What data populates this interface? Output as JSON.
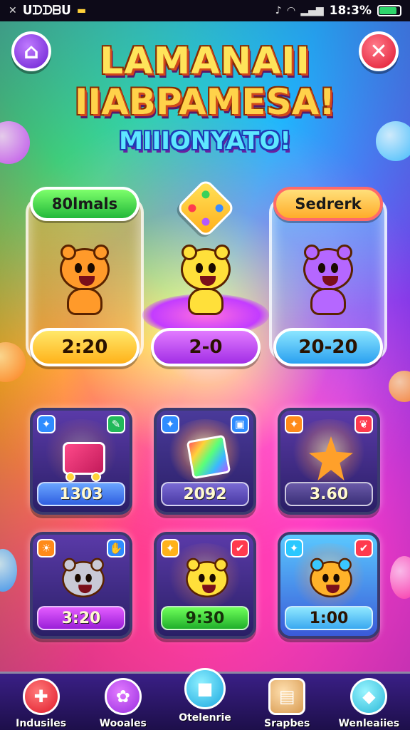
{
  "status_bar": {
    "carrier": "ᑌᗪᗪᗷᑌ",
    "time": "18:3%"
  },
  "title": {
    "line1": "LAMANAII",
    "line2": "IIABPAMESA!",
    "subtitle": "MIIIONYATO!"
  },
  "features": [
    {
      "tag": "80lmals",
      "price": "2:20",
      "color": "orange",
      "mascot_color": "orange"
    },
    {
      "tag": "",
      "price": "2-0",
      "color": "purple",
      "mascot_color": "yellow"
    },
    {
      "tag": "Sedrerk",
      "price": "20-20",
      "color": "blue",
      "mascot_color": "purple"
    }
  ],
  "items": [
    {
      "label": "1303",
      "badge_left_icon": "sparkle-icon",
      "badge_right_icon": "pencil-icon"
    },
    {
      "label": "2092",
      "badge_left_icon": "sparkle-icon",
      "badge_right_icon": "bag-icon"
    },
    {
      "label": "3.60",
      "badge_left_icon": "sparkle-icon",
      "badge_right_icon": "ribbon-icon"
    },
    {
      "label": "3:20",
      "badge_left_icon": "sun-icon",
      "badge_right_icon": "hand-icon"
    },
    {
      "label": "9:30",
      "badge_left_icon": "sparkle-icon",
      "badge_right_icon": "check-icon"
    },
    {
      "label": "1:00",
      "badge_left_icon": "sparkle-icon",
      "badge_right_icon": "check-icon"
    }
  ],
  "nav": [
    {
      "label": "Indusiles",
      "icon": "puzzle-icon"
    },
    {
      "label": "Wooales",
      "icon": "flower-icon"
    },
    {
      "label": "Otelenrie",
      "icon": "square-icon"
    },
    {
      "label": "Srapbes",
      "icon": "cards-icon"
    },
    {
      "label": "Wenleaiies",
      "icon": "gems-icon"
    }
  ],
  "glyphs": {
    "home": "⌂",
    "close": "✕",
    "wifi": "◠",
    "signal": "▮",
    "sparkle": "✦",
    "pencil": "✎",
    "bag": "▣",
    "ribbon": "❦",
    "sun": "☀",
    "hand": "✋",
    "check": "✔",
    "puzzle": "✚",
    "flower": "✿",
    "square": "■",
    "cards": "▤",
    "gems": "◆"
  }
}
